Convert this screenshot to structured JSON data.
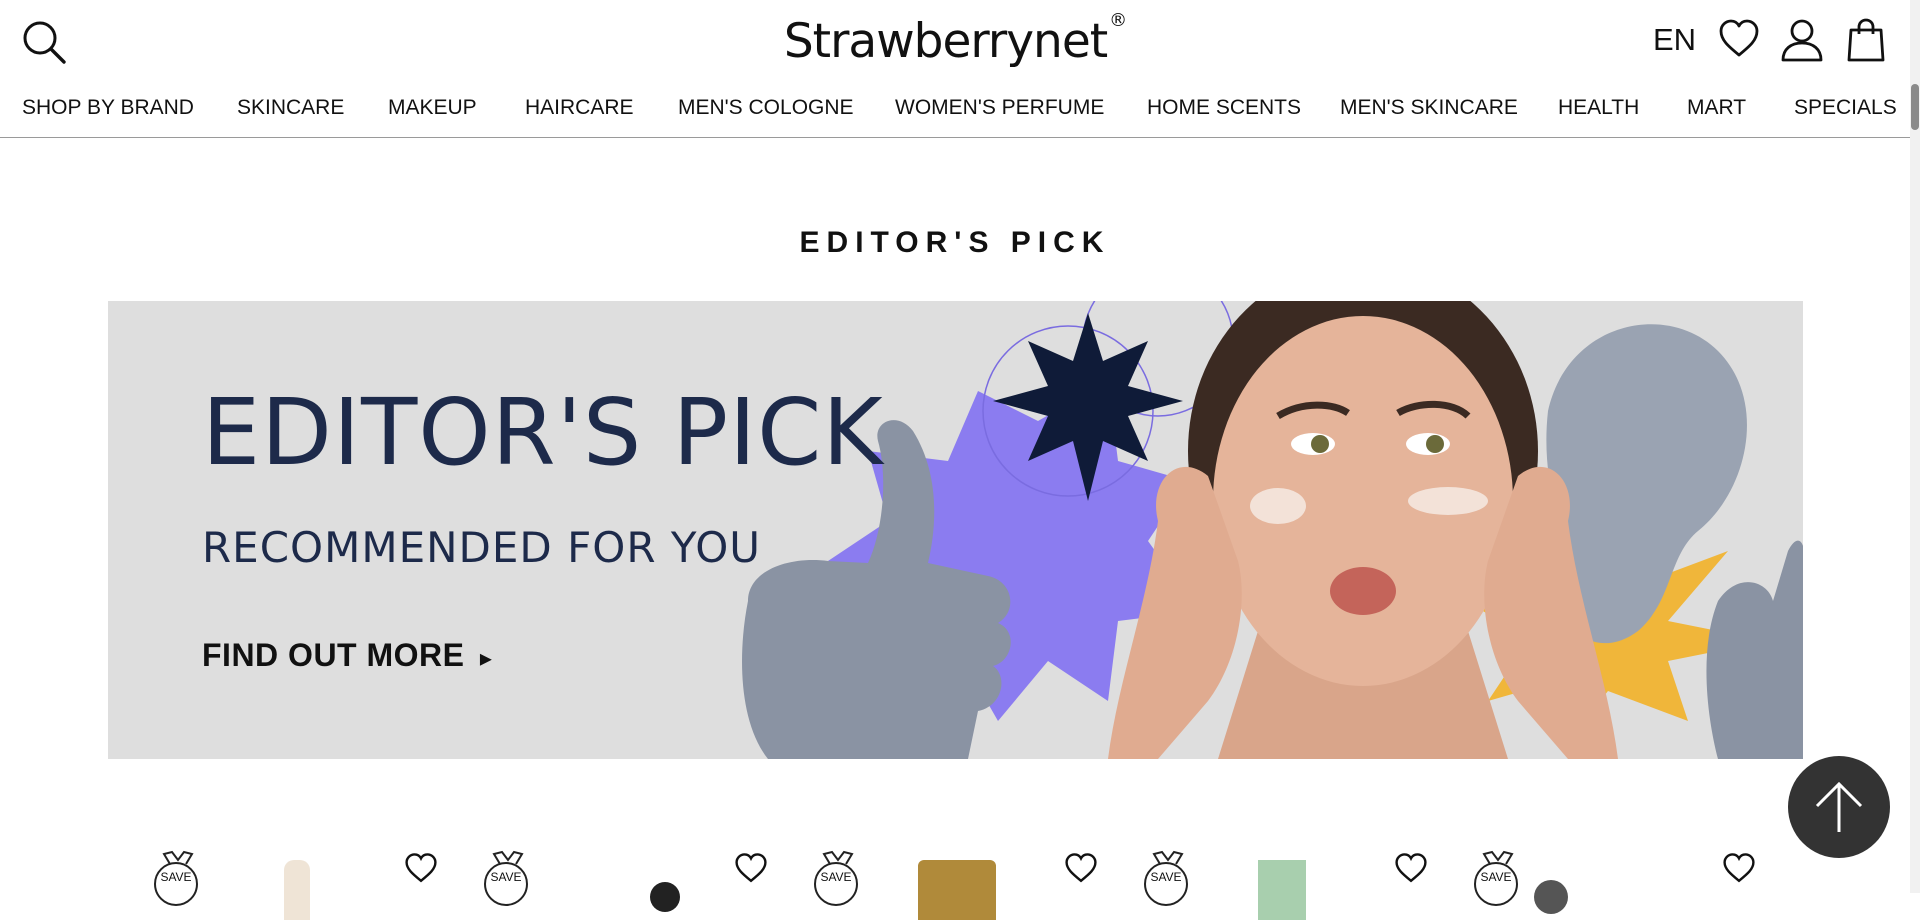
{
  "header": {
    "brand": "Strawberrynet",
    "brand_mark": "®",
    "language": "EN",
    "icons": [
      "search-icon",
      "heart-icon",
      "user-icon",
      "bag-icon"
    ]
  },
  "nav": {
    "items": [
      {
        "label": "SHOP BY BRAND"
      },
      {
        "label": "SKINCARE"
      },
      {
        "label": "MAKEUP"
      },
      {
        "label": "HAIRCARE"
      },
      {
        "label": "MEN'S COLOGNE"
      },
      {
        "label": "WOMEN'S PERFUME"
      },
      {
        "label": "HOME SCENTS"
      },
      {
        "label": "MEN'S SKINCARE"
      },
      {
        "label": "HEALTH"
      },
      {
        "label": "MART"
      },
      {
        "label": "SPECIALS"
      }
    ]
  },
  "section": {
    "title": "EDITOR'S PICK"
  },
  "banner": {
    "title": "EDITOR'S PICK",
    "subtitle": "RECOMMENDED FOR YOU",
    "cta": "FIND OUT MORE",
    "cta_arrow": "▸",
    "colors": {
      "background": "#dedede",
      "navy": "#0f1b38",
      "purple": "#8b7cf0",
      "yellow": "#f0b63a"
    }
  },
  "products": [
    {
      "badge": "SAVE"
    },
    {
      "badge": "SAVE"
    },
    {
      "badge": "SAVE"
    },
    {
      "badge": "SAVE"
    },
    {
      "badge": "SAVE"
    }
  ],
  "back_to_top": {
    "icon": "arrow-up-icon"
  }
}
